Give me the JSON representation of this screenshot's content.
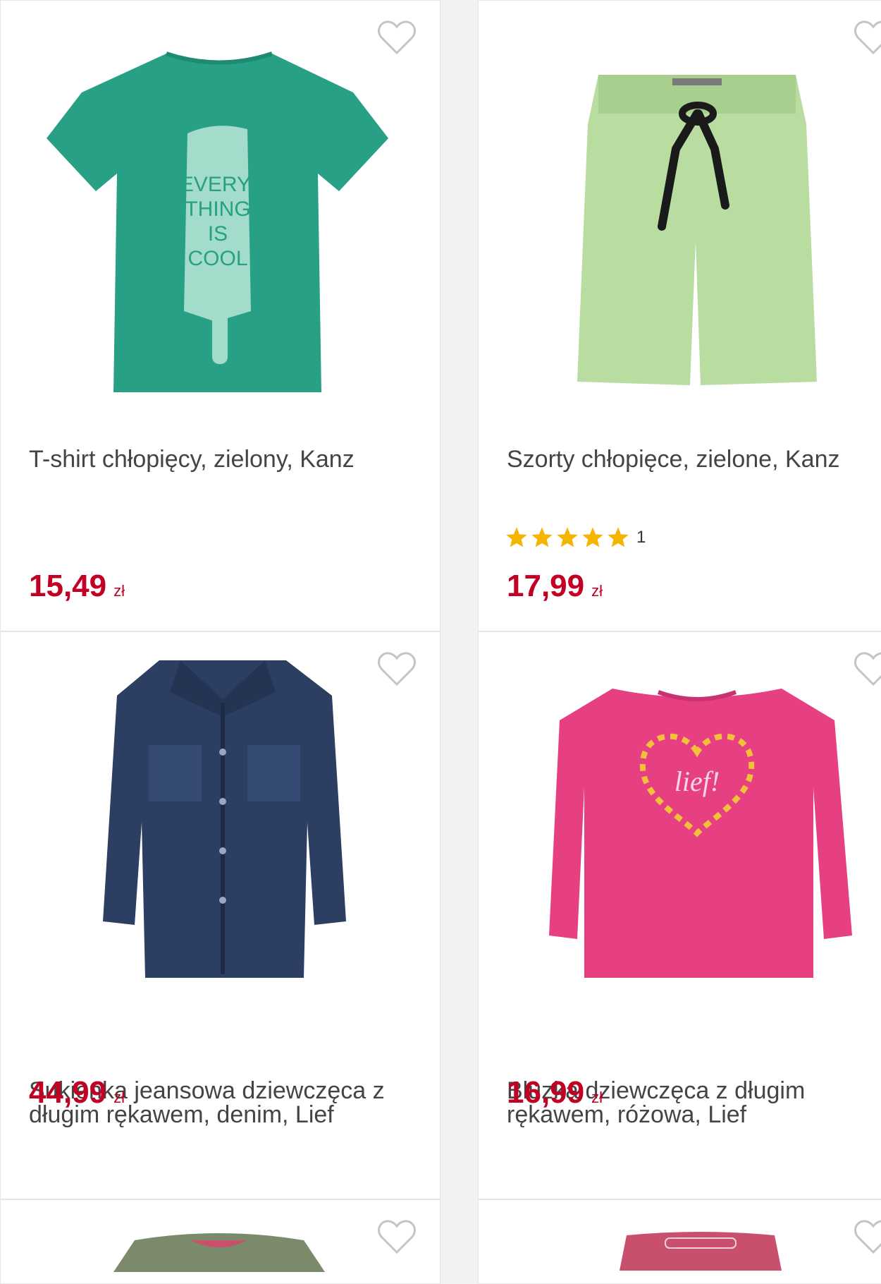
{
  "products": [
    {
      "title": "T-shirt chłopięcy, zielony, Kanz",
      "price": "15,49",
      "currency": "zł",
      "color": "#27a086",
      "image": "tshirt-green"
    },
    {
      "title": "Szorty chłopięce, zielone, Kanz",
      "price": "17,99",
      "currency": "zł",
      "rating_stars": 5,
      "rating_count": "1",
      "color": "#b9dca0",
      "image": "shorts-green"
    },
    {
      "title": "Sukienka jeansowa dziewczęca z długim rękawem, denim, Lief",
      "price": "44,99",
      "currency": "zł",
      "color": "#2c3f63",
      "image": "denim-dress"
    },
    {
      "title": "Bluzka dziewczęca z długim rękawem, różowa, Lief",
      "price": "16,99",
      "currency": "zł",
      "color": "#e63f82",
      "image": "pink-longsleeve"
    },
    {
      "title": "",
      "price": "",
      "currency": "",
      "color": "#7a8a6a",
      "image": "olive-top"
    },
    {
      "title": "",
      "price": "",
      "currency": "",
      "color": "#c9506d",
      "image": "pink-pants"
    }
  ],
  "colors": {
    "price": "#c10024",
    "star": "#f5b400",
    "heart": "#c4c4c4"
  },
  "tshirt_print": [
    "EVERY-",
    "THING",
    "IS",
    "COOL"
  ],
  "blouse_print": "lief!"
}
